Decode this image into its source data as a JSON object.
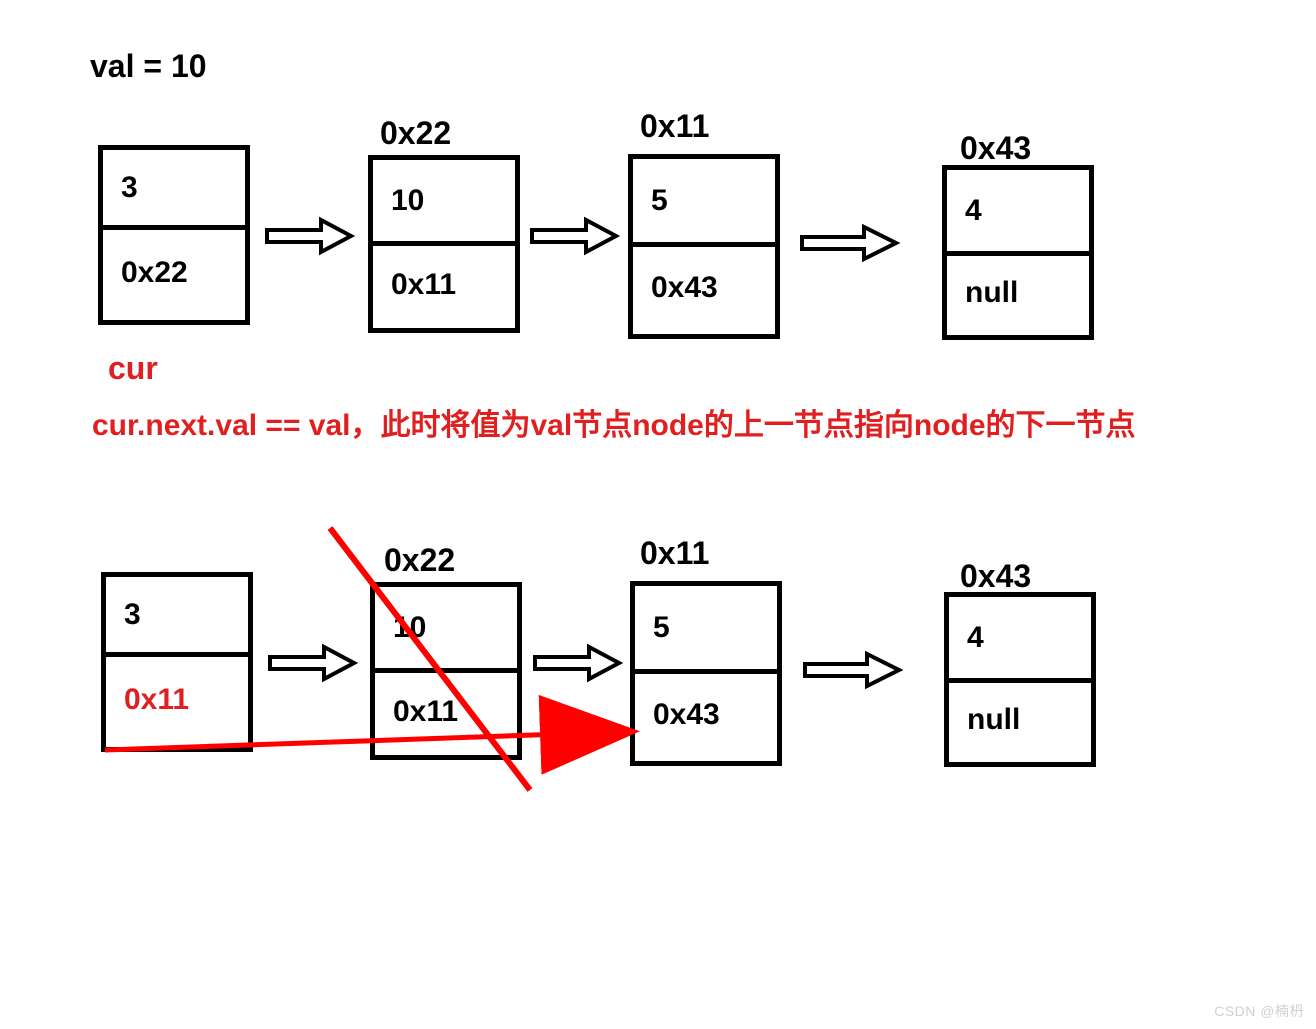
{
  "title": "val = 10",
  "row1": {
    "addrs": [
      "0x22",
      "0x11",
      "0x43"
    ],
    "nodes": [
      {
        "val": "3",
        "next": "0x22"
      },
      {
        "val": "10",
        "next": "0x11"
      },
      {
        "val": "5",
        "next": "0x43"
      },
      {
        "val": "4",
        "next": "null"
      }
    ]
  },
  "labels": {
    "cur": "cur",
    "note": "cur.next.val == val，此时将值为val节点node的上一节点指向node的下一节点"
  },
  "row2": {
    "addrs": [
      "0x22",
      "0x11",
      "0x43"
    ],
    "nodes": [
      {
        "val": "3",
        "next": "0x11",
        "next_red": true
      },
      {
        "val": "10",
        "next": "0x11"
      },
      {
        "val": "5",
        "next": "0x43"
      },
      {
        "val": "4",
        "next": "null"
      }
    ]
  },
  "watermark": "CSDN @楠枬"
}
